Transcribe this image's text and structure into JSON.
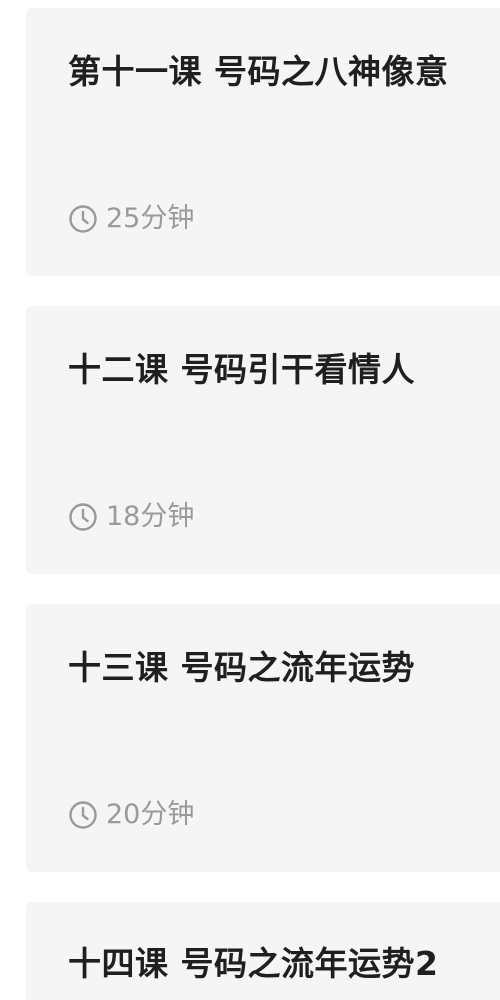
{
  "courses": [
    {
      "title": "第十一课 号码之八神像意",
      "duration": "25分钟",
      "icon": "clock-icon"
    },
    {
      "title": "十二课 号码引干看情人",
      "duration": "18分钟",
      "icon": "clock-icon"
    },
    {
      "title": "十三课 号码之流年运势",
      "duration": "20分钟",
      "icon": "clock-icon"
    },
    {
      "title": "十四课 号码之流年运势2"
    }
  ],
  "colors": {
    "card_background": "#f5f5f5",
    "title_text": "#1f1f1f",
    "meta_text": "#9a9a9a"
  }
}
